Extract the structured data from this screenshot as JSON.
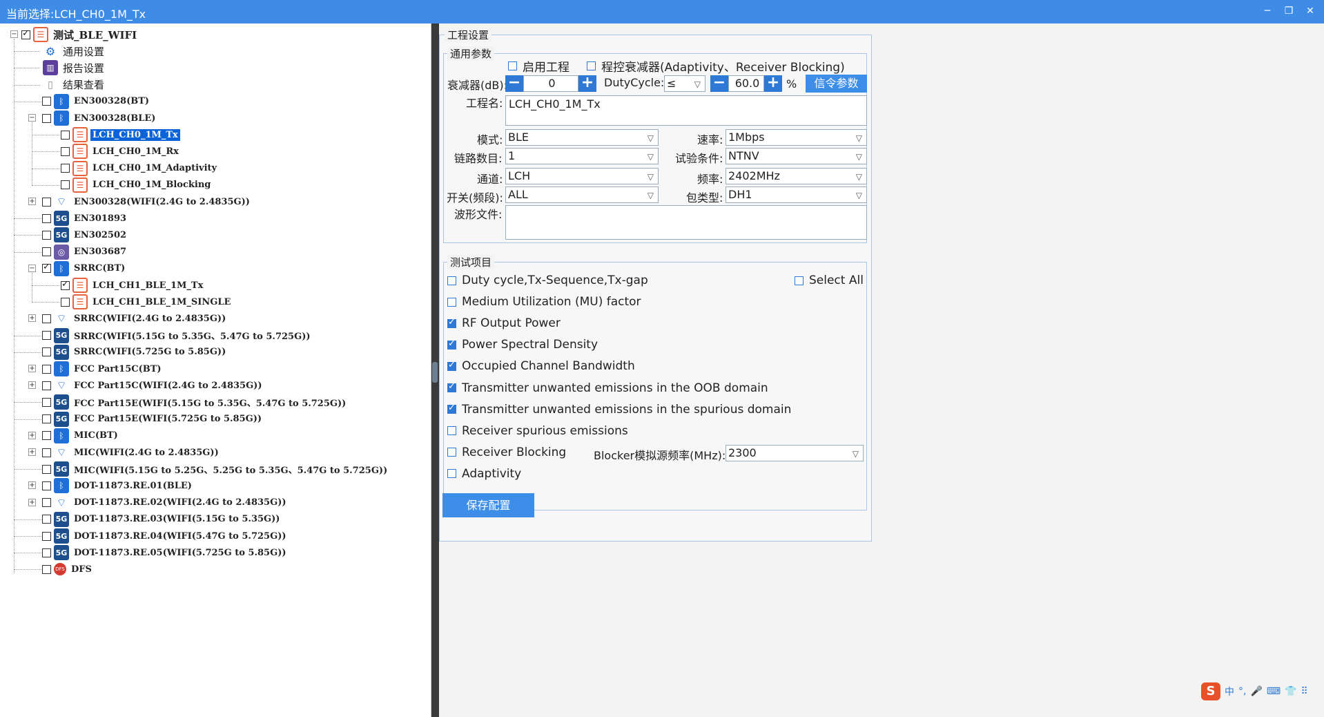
{
  "window": {
    "title": "当前选择:LCH_CH0_1M_Tx"
  },
  "tree": {
    "root": {
      "label": "测试_BLE_WIFI",
      "checked": true
    },
    "settings": [
      {
        "label": "通用设置",
        "icon": "settings-icon"
      },
      {
        "label": "报告设置",
        "icon": "report-icon"
      },
      {
        "label": "结果查看",
        "icon": "results-icon"
      }
    ],
    "nodes": [
      {
        "label": "EN300328(BT)",
        "icon": "bluetooth-icon",
        "checked": false,
        "expander": "none"
      },
      {
        "label": "EN300328(BLE)",
        "icon": "bluetooth-icon",
        "checked": false,
        "expander": "minus"
      },
      {
        "label": "LCH_CH0_1M_Tx",
        "icon": "list-icon",
        "checked": false,
        "child": true,
        "selected": true
      },
      {
        "label": "LCH_CH0_1M_Rx",
        "icon": "list-icon",
        "checked": false,
        "child": true
      },
      {
        "label": "LCH_CH0_1M_Adaptivity",
        "icon": "list-icon",
        "checked": false,
        "child": true
      },
      {
        "label": "LCH_CH0_1M_Blocking",
        "icon": "list-icon",
        "checked": false,
        "child": true
      },
      {
        "label": "EN300328(WIFI(2.4G to 2.4835G))",
        "icon": "wifi-icon",
        "checked": false,
        "expander": "plus"
      },
      {
        "label": "EN301893",
        "icon": "wifi-5g-icon",
        "checked": false,
        "expander": "none"
      },
      {
        "label": "EN302502",
        "icon": "wifi-5g-icon",
        "checked": false,
        "expander": "none"
      },
      {
        "label": "EN303687",
        "icon": "radar-icon",
        "checked": false,
        "expander": "none"
      },
      {
        "label": "SRRC(BT)",
        "icon": "bluetooth-icon",
        "checked": true,
        "expander": "minus"
      },
      {
        "label": "LCH_CH1_BLE_1M_Tx",
        "icon": "list-icon",
        "checked": true,
        "child": true
      },
      {
        "label": "LCH_CH1_BLE_1M_SINGLE",
        "icon": "list-icon",
        "checked": false,
        "child": true
      },
      {
        "label": "SRRC(WIFI(2.4G to 2.4835G))",
        "icon": "wifi-icon",
        "checked": false,
        "expander": "plus"
      },
      {
        "label": "SRRC(WIFI(5.15G to 5.35G、5.47G to 5.725G))",
        "icon": "wifi-5g-icon",
        "checked": false,
        "expander": "none"
      },
      {
        "label": "SRRC(WIFI(5.725G to 5.85G))",
        "icon": "wifi-5g-icon",
        "checked": false,
        "expander": "none"
      },
      {
        "label": "FCC Part15C(BT)",
        "icon": "bluetooth-icon",
        "checked": false,
        "expander": "plus"
      },
      {
        "label": "FCC Part15C(WIFI(2.4G to 2.4835G))",
        "icon": "wifi-icon",
        "checked": false,
        "expander": "plus"
      },
      {
        "label": "FCC Part15E(WIFI(5.15G to 5.35G、5.47G to 5.725G))",
        "icon": "wifi-5g-icon",
        "checked": false,
        "expander": "none"
      },
      {
        "label": "FCC Part15E(WIFI(5.725G to 5.85G))",
        "icon": "wifi-5g-icon",
        "checked": false,
        "expander": "none"
      },
      {
        "label": "MIC(BT)",
        "icon": "bluetooth-icon",
        "checked": false,
        "expander": "plus"
      },
      {
        "label": "MIC(WIFI(2.4G to 2.4835G))",
        "icon": "wifi-icon",
        "checked": false,
        "expander": "plus"
      },
      {
        "label": "MIC(WIFI(5.15G to 5.25G、5.25G to 5.35G、5.47G to 5.725G))",
        "icon": "wifi-5g-icon",
        "checked": false,
        "expander": "none"
      },
      {
        "label": "DOT-11873.RE.01(BLE)",
        "icon": "bluetooth-icon",
        "checked": false,
        "expander": "plus"
      },
      {
        "label": "DOT-11873.RE.02(WIFI(2.4G to 2.4835G))",
        "icon": "wifi-icon",
        "checked": false,
        "expander": "plus"
      },
      {
        "label": "DOT-11873.RE.03(WIFI(5.15G to 5.35G))",
        "icon": "wifi-5g-icon",
        "checked": false,
        "expander": "none"
      },
      {
        "label": "DOT-11873.RE.04(WIFI(5.47G to 5.725G))",
        "icon": "wifi-5g-icon",
        "checked": false,
        "expander": "none"
      },
      {
        "label": "DOT-11873.RE.05(WIFI(5.725G to 5.85G))",
        "icon": "wifi-5g-icon",
        "checked": false,
        "expander": "none"
      },
      {
        "label": "DFS",
        "icon": "dfs-icon",
        "checked": false,
        "expander": "none"
      }
    ]
  },
  "project": {
    "group_title": "工程设置",
    "general_title": "通用参数",
    "enable_label": "启用工程",
    "attenuator_ctrl_label": "程控衰减器(Adaptivity、Receiver Blocking)",
    "attenuator_label": "衰减器(dB):",
    "attenuator_value": "0",
    "dutycycle_label": "DutyCycle:",
    "dutycycle_op": "≤",
    "dutycycle_value": "60.0",
    "percent": "%",
    "signal_btn": "信令参数",
    "name_label": "工程名:",
    "name_value": "LCH_CH0_1M_Tx",
    "mode_label": "模式:",
    "mode_value": "BLE",
    "rate_label": "速率:",
    "rate_value": "1Mbps",
    "links_label": "链路数目:",
    "links_value": "1",
    "condition_label": "试验条件:",
    "condition_value": "NTNV",
    "channel_label": "通道:",
    "channel_value": "LCH",
    "freq_label": "频率:",
    "freq_value": "2402MHz",
    "switch_label": "开关(频段):",
    "switch_value": "ALL",
    "packet_label": "包类型:",
    "packet_value": "DH1",
    "waveform_label": "波形文件:",
    "waveform_value": ""
  },
  "tests": {
    "title": "测试项目",
    "select_all": "Select All",
    "items": [
      {
        "label": "Duty cycle,Tx-Sequence,Tx-gap",
        "checked": false
      },
      {
        "label": "Medium Utilization (MU) factor",
        "checked": false
      },
      {
        "label": "RF Output Power",
        "checked": true
      },
      {
        "label": "Power Spectral Density",
        "checked": true
      },
      {
        "label": "Occupied Channel Bandwidth",
        "checked": true
      },
      {
        "label": "Transmitter unwanted emissions in the OOB domain",
        "checked": true
      },
      {
        "label": "Transmitter unwanted emissions in the spurious domain",
        "checked": true
      },
      {
        "label": "Receiver spurious emissions",
        "checked": false
      },
      {
        "label": "Receiver Blocking",
        "checked": false
      },
      {
        "label": "Adaptivity",
        "checked": false
      }
    ],
    "blocker_label": "Blocker模拟源频率(MHz):",
    "blocker_value": "2300"
  },
  "save_btn": "保存配置",
  "tray": [
    "中",
    "°,",
    "🎤",
    "⌨",
    "👕",
    "⠿"
  ]
}
